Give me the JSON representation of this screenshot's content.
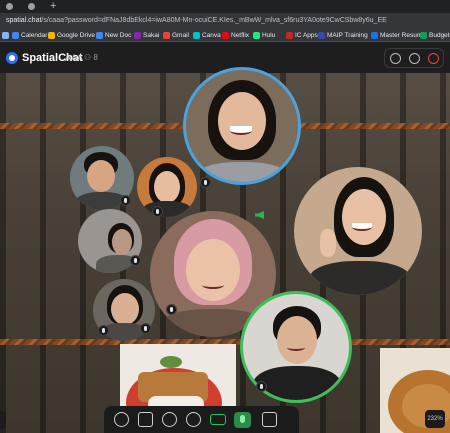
{
  "browser": {
    "url_host": "spatial.chat",
    "url_path": "/s/caaa?password=dFNaJ8dbEkcl4=iwA80M-Mn-ocuiCE.KIes._mBwW_mlva_sf6ru3YA0ote9CwCSbw8y6u_EE",
    "bookmarks": [
      {
        "label": "Calendar",
        "color": "#4285f4"
      },
      {
        "label": "Google Drive",
        "color": "#f4b400"
      },
      {
        "label": "New Doc",
        "color": "#4285f4"
      },
      {
        "label": "Sakai",
        "color": "#8e24aa"
      },
      {
        "label": "Gmail",
        "color": "#ea4335"
      },
      {
        "label": "Canva",
        "color": "#00c4cc"
      },
      {
        "label": "Netflix",
        "color": "#e50914"
      },
      {
        "label": "Hulu",
        "color": "#1ce783"
      },
      {
        "label": "IC Apps",
        "color": "#c62828"
      },
      {
        "label": "MAIP Training",
        "color": "#3949ab"
      },
      {
        "label": "Master Resume",
        "color": "#1a73e8"
      },
      {
        "label": "Budget",
        "color": "#0f9d58"
      }
    ]
  },
  "app": {
    "name": "SpatialChat",
    "room": "AAA",
    "user_count": "8",
    "zoom_level": "232%",
    "accent": "#2f6df6",
    "active_ring": "#4aa3df",
    "speaking_ring": "#3fbf5a"
  },
  "top_icons": [
    "settings-icon",
    "help-icon",
    "power-icon"
  ],
  "toolbar_icons": [
    "plus-icon",
    "screen-share-icon",
    "chat-icon",
    "broadcast-icon",
    "camera-icon",
    "microphone-icon",
    "megaphone-icon"
  ]
}
